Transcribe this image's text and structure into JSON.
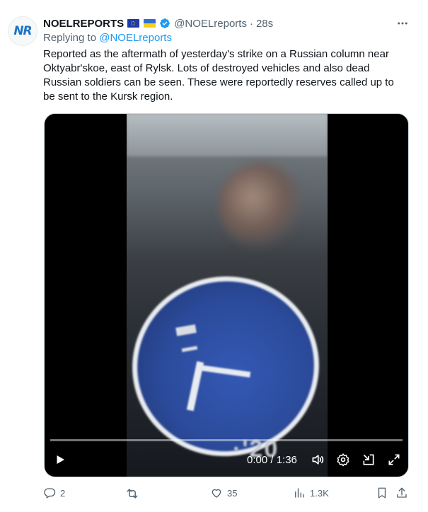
{
  "tweet": {
    "avatar_text": "NR",
    "name": "NOELREPORTS",
    "handle": "@NOELreports",
    "dot": "·",
    "time": "28s",
    "replying_prefix": "Replying to",
    "replying_handle": "@NOELreports",
    "text": "Reported as the aftermath of yesterday's strike on a Russian column near Oktyabr'skoe, east of Rylsk. Lots of destroyed vehicles and also dead Russian soldiers can be seen. These were reportedly reserves called up to be sent to the Kursk region."
  },
  "video": {
    "timecode": "0:00 / 1:36",
    "progress": 0,
    "overlay_text": "·'20"
  },
  "actions": {
    "replies": "2",
    "retweets": "",
    "likes": "35",
    "views": "1.3K"
  },
  "colors": {
    "accent": "#1d9bf0",
    "muted": "#536471",
    "text": "#0f1419",
    "flag_blue": "#2f6fd6",
    "flag_yellow": "#f7d117"
  },
  "icons": [
    "eu-flag-icon",
    "ukraine-flag-icon",
    "verified-badge-icon",
    "more-icon",
    "play-icon",
    "volume-icon",
    "settings-icon",
    "minimize-icon",
    "fullscreen-icon",
    "reply-icon",
    "retweet-icon",
    "like-icon",
    "views-icon",
    "bookmark-icon",
    "share-icon"
  ]
}
